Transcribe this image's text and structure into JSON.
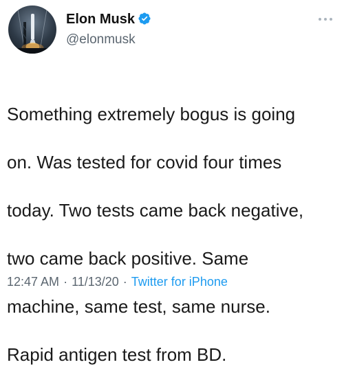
{
  "tweet": {
    "author": {
      "display_name": "Elon Musk",
      "handle": "@elonmusk",
      "verified": true,
      "avatar_icon": "rocket-launch-avatar"
    },
    "more_icon": "more-options-icon",
    "lines": [
      "Something extremely bogus is going",
      "on. Was tested for covid four times",
      "today. Two tests came back negative,",
      "two came back positive. Same",
      "machine, same test, same nurse.",
      "Rapid antigen test from BD."
    ],
    "meta": {
      "time": "12:47 AM",
      "separator": "·",
      "date": "11/13/20",
      "source": "Twitter for iPhone"
    }
  },
  "colors": {
    "verified_blue": "#1d9bf0",
    "secondary_text": "#5b6670",
    "link_blue": "#1d9bf0"
  }
}
